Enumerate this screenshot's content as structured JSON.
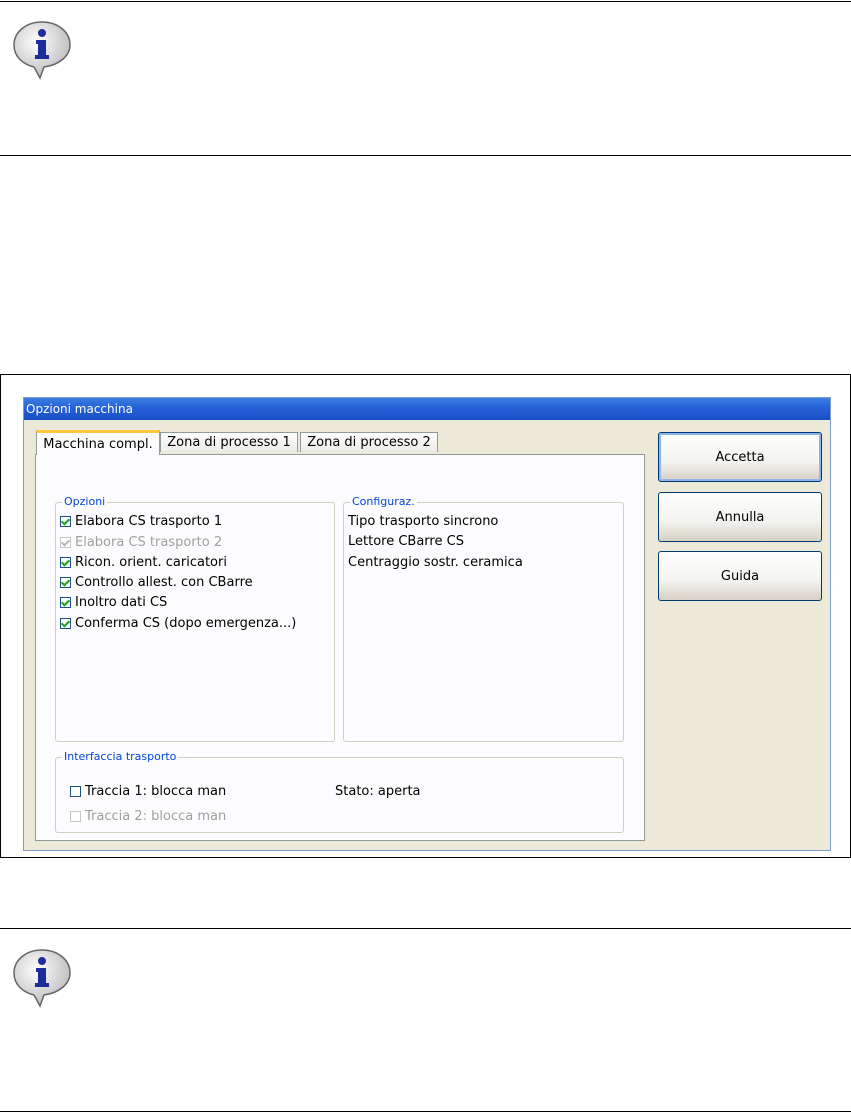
{
  "dialog": {
    "title": "Opzioni macchina",
    "tabs": [
      {
        "label": "Macchina compl.",
        "active": true
      },
      {
        "label": "Zona di processo 1",
        "active": false
      },
      {
        "label": "Zona di processo 2",
        "active": false
      }
    ],
    "options_group": {
      "legend": "Opzioni",
      "items": [
        {
          "label": "Elabora CS trasporto 1",
          "checked": true,
          "enabled": true
        },
        {
          "label": "Elabora CS trasporto 2",
          "checked": true,
          "enabled": false
        },
        {
          "label": "Ricon. orient. caricatori",
          "checked": true,
          "enabled": true
        },
        {
          "label": "Controllo allest. con CBarre",
          "checked": true,
          "enabled": true
        },
        {
          "label": "Inoltro dati CS",
          "checked": true,
          "enabled": true
        },
        {
          "label": "Conferma CS (dopo emergenza...)",
          "checked": true,
          "enabled": true
        }
      ]
    },
    "config_group": {
      "legend": "Configuraz.",
      "lines": [
        "Tipo trasporto sincrono",
        "Lettore CBarre CS",
        "Centraggio sostr. ceramica"
      ]
    },
    "interface_group": {
      "legend": "Interfaccia trasporto",
      "track1": {
        "label": "Traccia 1: blocca man",
        "checked": false,
        "enabled": true
      },
      "track2": {
        "label": "Traccia 2: blocca man",
        "checked": false,
        "enabled": false
      },
      "status": "Stato: aperta"
    },
    "buttons": {
      "accept": "Accetta",
      "cancel": "Annulla",
      "help": "Guida"
    }
  },
  "icons": {
    "top_note": "info-icon",
    "bottom_note": "info-icon"
  }
}
